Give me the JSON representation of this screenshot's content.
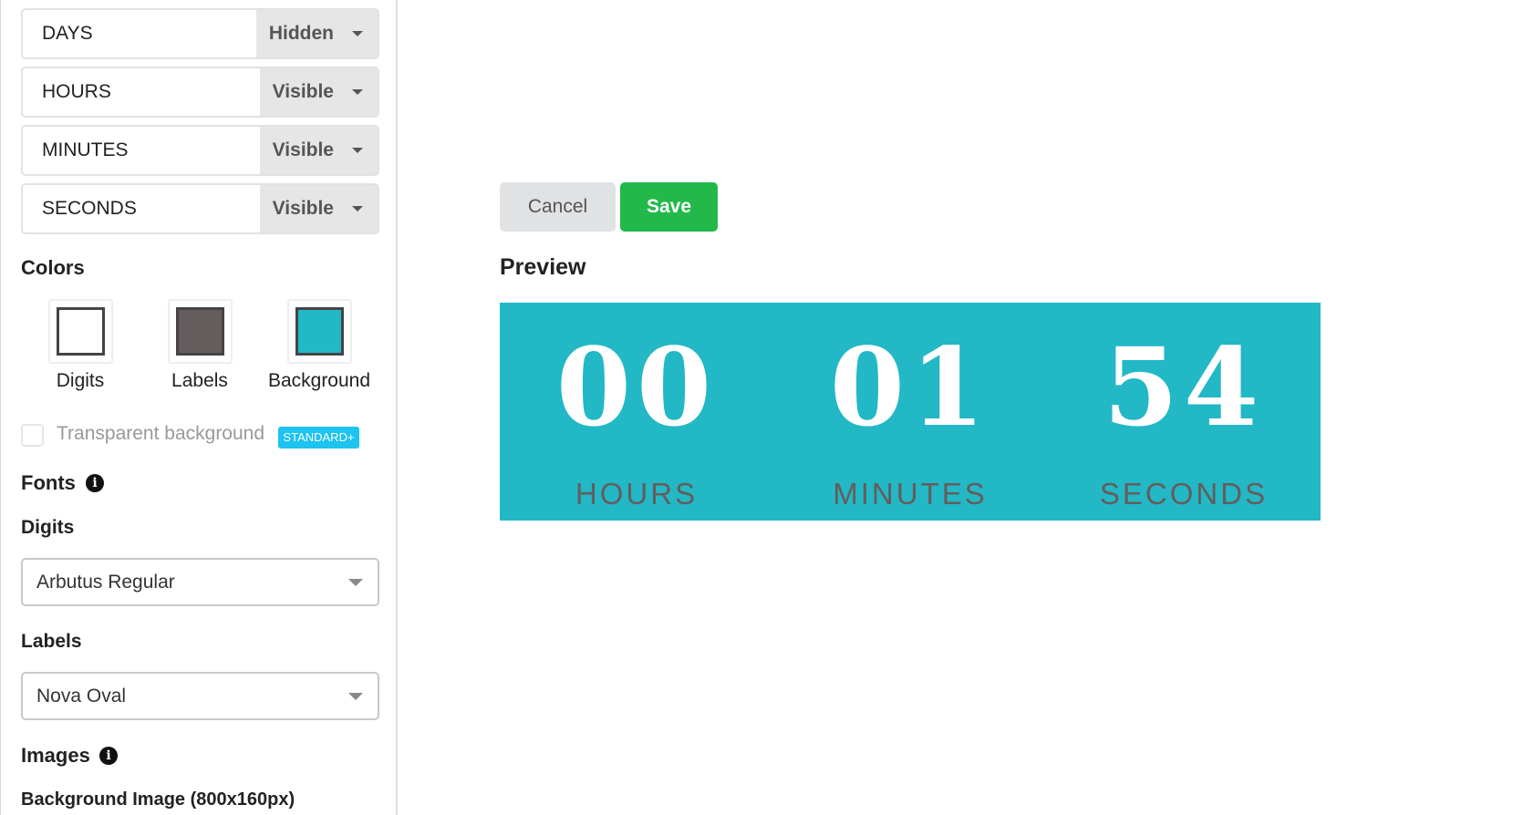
{
  "units": [
    {
      "name": "DAYS",
      "visibility": "Hidden"
    },
    {
      "name": "HOURS",
      "visibility": "Visible"
    },
    {
      "name": "MINUTES",
      "visibility": "Visible"
    },
    {
      "name": "SECONDS",
      "visibility": "Visible"
    }
  ],
  "colors": {
    "heading": "Colors",
    "swatches": [
      {
        "label": "Digits",
        "value": "#ffffff"
      },
      {
        "label": "Labels",
        "value": "#655d5d"
      },
      {
        "label": "Background",
        "value": "#22b8c5"
      }
    ]
  },
  "transparent": {
    "label": "Transparent background",
    "checked": false,
    "badge": "STANDARD+"
  },
  "fonts": {
    "heading": "Fonts",
    "info_icon": "info-icon",
    "digits_label": "Digits",
    "digits_value": "Arbutus Regular",
    "labels_label": "Labels",
    "labels_value": "Nova Oval"
  },
  "images": {
    "heading": "Images",
    "info_icon": "info-icon",
    "background_image_label": "Background Image (800x160px)"
  },
  "actions": {
    "cancel": "Cancel",
    "save": "Save"
  },
  "preview": {
    "title": "Preview",
    "segments": [
      {
        "digits": "00",
        "label": "HOURS"
      },
      {
        "digits": "01",
        "label": "MINUTES"
      },
      {
        "digits": "54",
        "label": "SECONDS"
      }
    ]
  }
}
